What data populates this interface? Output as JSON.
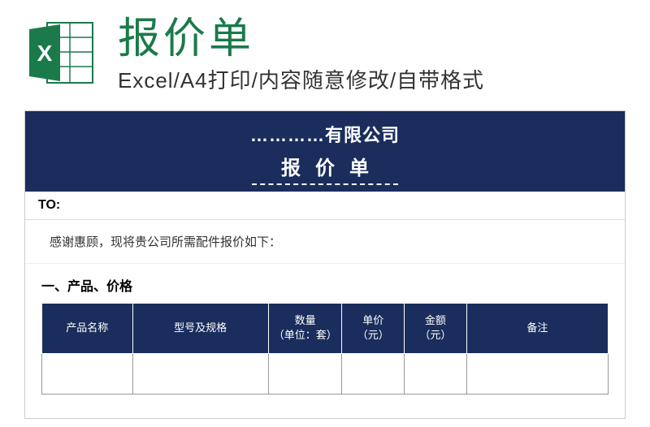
{
  "header": {
    "main_title": "报价单",
    "subtitle": "Excel/A4打印/内容随意修改/自带格式",
    "icon_name": "excel-icon"
  },
  "document": {
    "company_name": "…………有限公司",
    "doc_title": "报价单",
    "to_label": "TO:",
    "thanks_text": "感谢惠顾，现将贵公司所需配件报价如下：",
    "section_title": "一、产品、价格",
    "table_headers": {
      "product_name": "产品名称",
      "spec": "型号及规格",
      "quantity": "数量\n（单位：套）",
      "unit_price": "单价\n（元）",
      "amount": "金额\n（元）",
      "remark": "备注"
    }
  }
}
